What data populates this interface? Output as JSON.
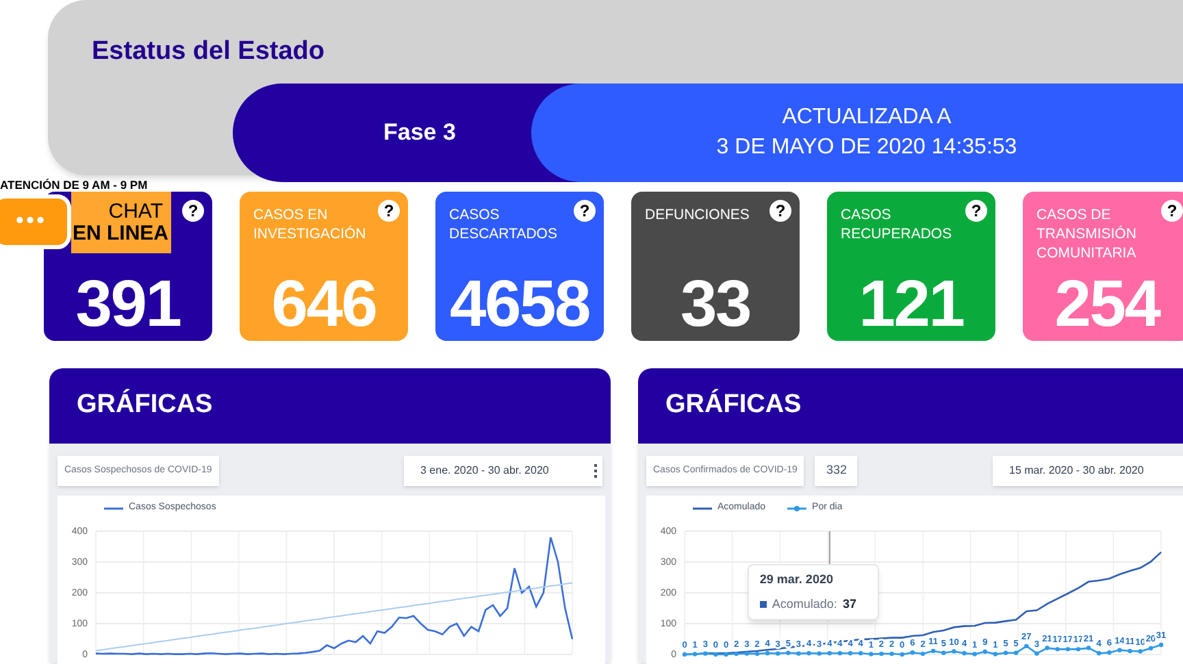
{
  "header": {
    "title": "Estatus del Estado",
    "phase": "Fase 3",
    "updated_lines": [
      "ACTUALIZADA A",
      "3 DE MAYO DE 2020 14:35:53"
    ]
  },
  "chat": {
    "hours": "ATENCIÓN DE 9 AM - 9 PM",
    "dots": "•••",
    "line_1": "CHAT",
    "line_2": "EN LINEA"
  },
  "cards": [
    {
      "value": "391",
      "help": "?",
      "color": "#2400a0"
    },
    {
      "label_lines": [
        "CASOS EN",
        "INVESTIGACIÓN"
      ],
      "value": "646",
      "help": "?",
      "color": "#ffa328"
    },
    {
      "label_lines": [
        "CASOS",
        "DESCARTADOS"
      ],
      "value": "4658",
      "help": "?",
      "color": "#2f5cff"
    },
    {
      "label_lines": [
        "DEFUNCIONES"
      ],
      "value": "33",
      "help": "?",
      "color": "#4a4a4a"
    },
    {
      "label_lines": [
        "CASOS",
        "RECUPERADOS"
      ],
      "value": "121",
      "help": "?",
      "color": "#0aab3c"
    },
    {
      "label_lines": [
        "CASOS DE",
        "TRANSMISIÓN",
        "COMUNITARIA"
      ],
      "value": "254",
      "help": "?",
      "color": "#ff6aa5"
    }
  ],
  "panels": [
    {
      "title": "GRÁFICAS",
      "chart_title": "Casos Sospechosos de COVID-19",
      "date_range": "3 ene. 2020 - 30 abr. 2020",
      "chart_data": {
        "type": "line",
        "yticks": [
          0,
          100,
          200,
          300,
          400
        ],
        "ylim": [
          0,
          400
        ],
        "grid": true,
        "legend": "top",
        "series": [
          {
            "name": "Casos Sospechosos",
            "color": "#3a6fd8",
            "values": [
              3,
              2,
              3,
              2,
              2,
              1,
              3,
              1,
              2,
              1,
              2,
              1,
              1,
              2,
              1,
              3,
              4,
              2,
              1,
              2,
              3,
              1,
              2,
              3,
              1,
              2,
              1,
              2,
              3,
              5,
              8,
              12,
              30,
              20,
              35,
              45,
              40,
              60,
              35,
              75,
              70,
              90,
              120,
              118,
              125,
              100,
              80,
              75,
              65,
              90,
              100,
              60,
              90,
              75,
              145,
              160,
              125,
              150,
              280,
              200,
              220,
              155,
              200,
              380,
              300,
              150,
              50
            ]
          },
          {
            "color": "#a9cdf2",
            "values": [
              12,
              15,
              19,
              22,
              25,
              29,
              32,
              35,
              39,
              42,
              45,
              49,
              52,
              55,
              59,
              62,
              65,
              69,
              72,
              75,
              79,
              82,
              85,
              89,
              92,
              95,
              99,
              102,
              105,
              109,
              112,
              115,
              119,
              122,
              125,
              129,
              132,
              135,
              139,
              142,
              145,
              149,
              152,
              155,
              159,
              162,
              165,
              169,
              172,
              175,
              179,
              182,
              185,
              189,
              192,
              195,
              199,
              202,
              205,
              209,
              212,
              215,
              219,
              222,
              225,
              229,
              232
            ]
          }
        ]
      }
    },
    {
      "title": "GRÁFICAS",
      "chart_title": "Casos Confirmados de COVID-19",
      "total": "332",
      "date_range": "15 mar. 2020 - 30 abr. 2020",
      "tooltip": {
        "date": "29 mar. 2020",
        "label": "Acomulado:",
        "value": "37"
      },
      "chart_data": {
        "type": "line",
        "yticks": [
          0,
          100,
          200,
          300,
          400
        ],
        "ylim": [
          0,
          400
        ],
        "grid": true,
        "legend": "top",
        "series": [
          {
            "name": "Acomulado",
            "color": "#2f5fb3",
            "values": [
              0,
              1,
              4,
              4,
              4,
              6,
              9,
              11,
              15,
              18,
              23,
              26,
              30,
              33,
              37,
              41,
              45,
              49,
              50,
              52,
              54,
              54,
              60,
              62,
              73,
              78,
              88,
              92,
              93,
              102,
              103,
              108,
              113,
              140,
              143,
              164,
              181,
              198,
              215,
              236,
              240,
              246,
              260,
              271,
              281,
              301,
              332
            ]
          },
          {
            "name": "Por dia",
            "color": "#2f9ae8",
            "marker": "circle",
            "values": [
              0,
              1,
              3,
              0,
              0,
              2,
              3,
              2,
              4,
              3,
              5,
              3,
              4,
              3,
              4,
              4,
              4,
              4,
              1,
              2,
              2,
              0,
              6,
              2,
              11,
              5,
              10,
              4,
              1,
              9,
              1,
              5,
              5,
              27,
              3,
              21,
              17,
              17,
              17,
              21,
              4,
              6,
              14,
              11,
              10,
              20,
              31
            ],
            "value_labels": [
              "0",
              "1",
              "3",
              "0",
              "0",
              "2",
              "3",
              "2",
              "4",
              "3",
              "5",
              "3",
              "4",
              "3",
              "4",
              "4",
              "4",
              "4",
              "1",
              "2",
              "2",
              "0",
              "6",
              "2",
              "11",
              "5",
              "10",
              "4",
              "1",
              "9",
              "1",
              "5",
              "5",
              "27",
              "3",
              "21",
              "17",
              "17",
              "17",
              "21",
              "4",
              "6",
              "14",
              "11",
              "10",
              "20",
              "31"
            ]
          }
        ]
      }
    }
  ]
}
